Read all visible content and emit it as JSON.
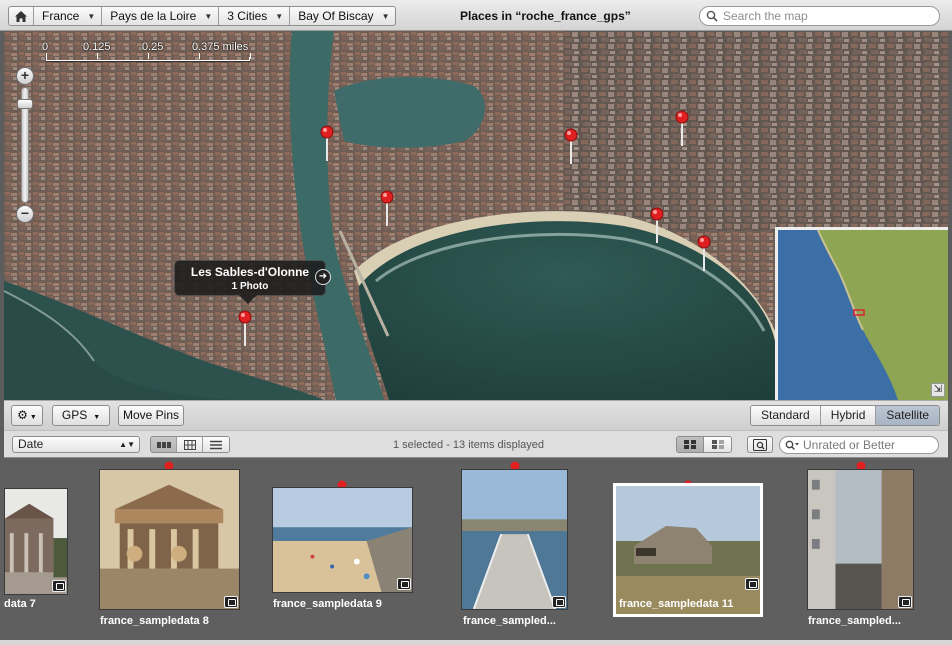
{
  "toolbar": {
    "breadcrumbs": [
      "France",
      "Pays de la Loire",
      "3 Cities",
      "Bay Of Biscay"
    ],
    "title": "Places in “roche_france_gps”",
    "search_placeholder": "Search the map"
  },
  "map": {
    "scale_labels": [
      "0",
      "0.125",
      "0.25",
      "0.375 miles"
    ],
    "callout": {
      "title": "Les Sables-d'Olonne",
      "subtitle": "1 Photo"
    },
    "pin_color": "#e02020",
    "water_color": "#3f6a66",
    "inset_sea_color": "#3d6fa7",
    "inset_land_color": "#8ea654"
  },
  "mapbar": {
    "gps_label": "GPS",
    "move_pins_label": "Move Pins",
    "map_types": [
      "Standard",
      "Hybrid",
      "Satellite"
    ],
    "selected_map_type": "Satellite"
  },
  "browser": {
    "sort_value": "Date",
    "status": "1 selected - 13 items displayed",
    "filter_placeholder": "Unrated or Better"
  },
  "photos": [
    {
      "caption": "data 7"
    },
    {
      "caption": "france_sampledata 8"
    },
    {
      "caption": "france_sampledata 9"
    },
    {
      "caption": "france_sampled..."
    },
    {
      "caption": "france_sampledata 11",
      "selected": true
    },
    {
      "caption": "france_sampled..."
    }
  ]
}
